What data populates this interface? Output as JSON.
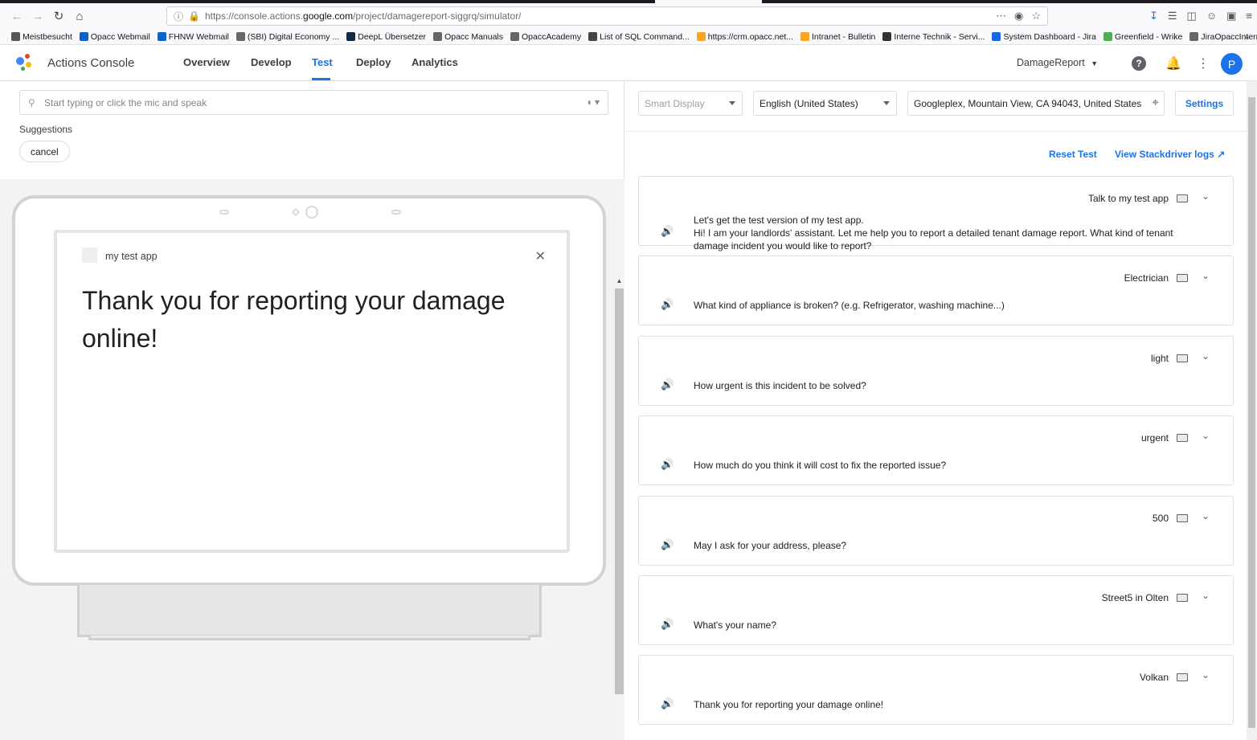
{
  "browser": {
    "url_prefix": "https://console.actions.",
    "url_domain": "google.com",
    "url_path": "/project/damagereport-siggrq/simulator/",
    "bookmarks": [
      "Meistbesucht",
      "Opacc Webmail",
      "FHNW Webmail",
      "(SBI) Digital Economy ...",
      "DeepL Übersetzer",
      "Opacc Manuals",
      "OpaccAcademy",
      "List of SQL Command...",
      "https://crm.opacc.net...",
      "Intranet - Bulletin",
      "Interne Technik - Servi...",
      "System Dashboard - Jira",
      "Greenfield - Wrike",
      "JiraOpaccIntern"
    ]
  },
  "header": {
    "title": "Actions Console",
    "tabs": [
      "Overview",
      "Develop",
      "Test",
      "Deploy",
      "Analytics"
    ],
    "active_tab": "Test",
    "project": "DamageReport",
    "avatar_initial": "P"
  },
  "left": {
    "input_placeholder": "Start typing or click the mic and speak",
    "suggestions_label": "Suggestions",
    "suggestions": [
      "cancel"
    ],
    "device": {
      "app_name": "my test app",
      "message": "Thank you for reporting your damage online!"
    }
  },
  "right": {
    "surface": "Smart Display",
    "language": "English (United States)",
    "location": "Googleplex, Mountain View, CA 94043, United States",
    "settings_label": "Settings",
    "reset_label": "Reset Test",
    "logs_label": "View Stackdriver logs",
    "conversation": [
      {
        "user": "Talk to my test app",
        "response": "Let's get the test version of my test app.\nHi! I am your landlords' assistant. Let me help you to report a detailed tenant damage report. What kind of tenant damage incident you would like to report?"
      },
      {
        "user": "Electrician",
        "response": "What kind of appliance is broken? (e.g. Refrigerator, washing machine...)"
      },
      {
        "user": "light",
        "response": "How urgent is this incident to be solved?"
      },
      {
        "user": "urgent",
        "response": "How much do you think it will cost to fix the reported issue?"
      },
      {
        "user": "500",
        "response": "May I ask for your address, please?"
      },
      {
        "user": "Street5 in Olten",
        "response": "What's your name?"
      },
      {
        "user": "Volkan",
        "response": "Thank you for reporting your damage online!"
      }
    ]
  },
  "colors": {
    "accent": "#1a73e8"
  }
}
